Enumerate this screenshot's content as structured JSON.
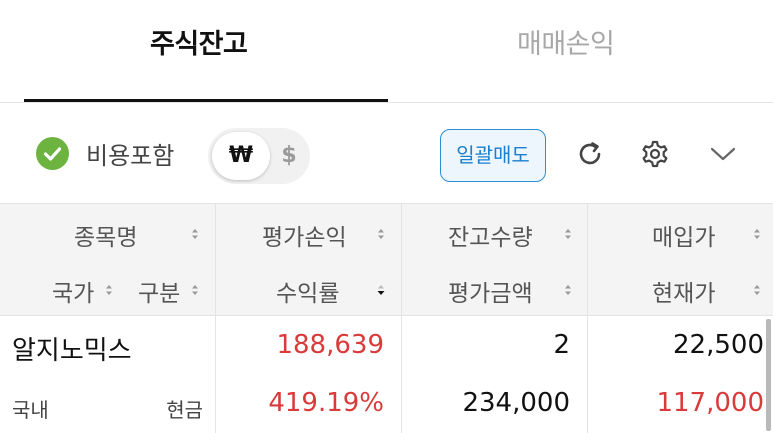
{
  "tabs": {
    "active": "주식잔고",
    "inactive": "매매손익"
  },
  "toolbar": {
    "include_fee_label": "비용포함",
    "include_fee_checked": true,
    "currency_won": "₩",
    "currency_dollar": "$",
    "bulk_sell_label": "일괄매도",
    "icons": [
      "check-circle-icon",
      "refresh-icon",
      "gear-icon",
      "chevron-down-icon"
    ],
    "accent_color": "#2b8ed8",
    "check_color": "#6cb33f"
  },
  "table": {
    "headers": {
      "name": "종목명",
      "country": "국가",
      "type": "구분",
      "eval_pl": "평가손익",
      "return_rate": "수익률",
      "quantity": "잔고수량",
      "eval_amount": "평가금액",
      "buy_price": "매입가",
      "current_price": "현재가"
    },
    "rows": [
      {
        "name": "알지노믹스",
        "country": "국내",
        "type": "현금",
        "eval_pl": "188,639",
        "return_rate": "419.19%",
        "quantity": "2",
        "eval_amount": "234,000",
        "buy_price": "22,500",
        "current_price": "117,000"
      }
    ],
    "colors": {
      "positive": "#d93a3a",
      "cash_type": "#4c9a2a"
    }
  }
}
